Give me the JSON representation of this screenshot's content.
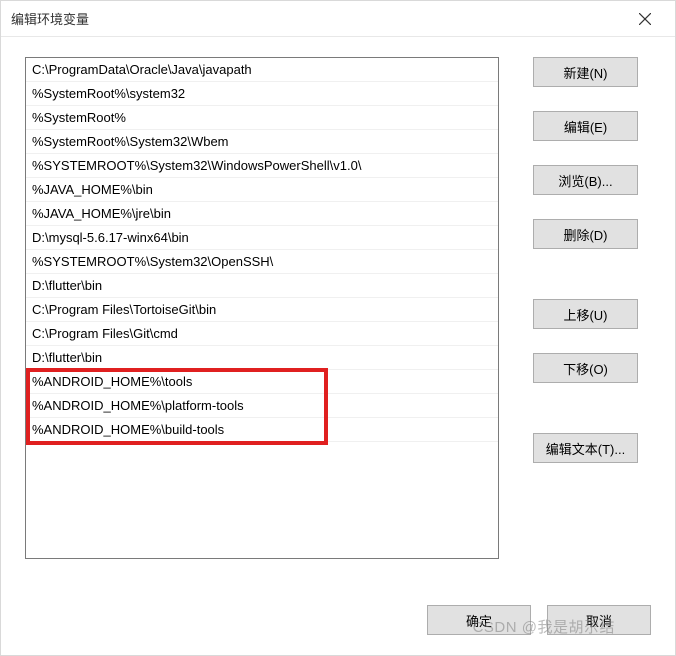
{
  "window": {
    "title": "编辑环境变量"
  },
  "list": {
    "items": [
      "C:\\ProgramData\\Oracle\\Java\\javapath",
      "%SystemRoot%\\system32",
      "%SystemRoot%",
      "%SystemRoot%\\System32\\Wbem",
      "%SYSTEMROOT%\\System32\\WindowsPowerShell\\v1.0\\",
      "%JAVA_HOME%\\bin",
      "%JAVA_HOME%\\jre\\bin",
      "D:\\mysql-5.6.17-winx64\\bin",
      "%SYSTEMROOT%\\System32\\OpenSSH\\",
      "D:\\flutter\\bin",
      "C:\\Program Files\\TortoiseGit\\bin",
      "C:\\Program Files\\Git\\cmd",
      "D:\\flutter\\bin",
      "%ANDROID_HOME%\\tools",
      "%ANDROID_HOME%\\platform-tools",
      "%ANDROID_HOME%\\build-tools"
    ]
  },
  "buttons": {
    "new": "新建(N)",
    "edit": "编辑(E)",
    "browse": "浏览(B)...",
    "delete": "删除(D)",
    "moveup": "上移(U)",
    "movedown": "下移(O)",
    "edittext": "编辑文本(T)...",
    "ok": "确定",
    "cancel": "取消"
  },
  "watermark": "CSDN @我是胡尕结"
}
